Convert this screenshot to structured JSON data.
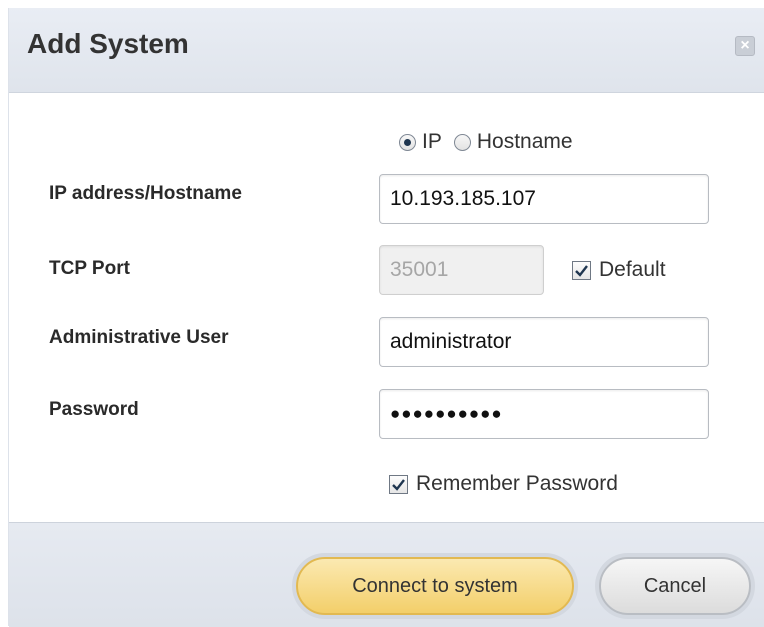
{
  "dialog": {
    "title": "Add System",
    "close_symbol": "×"
  },
  "address_type": {
    "options": [
      {
        "label": "IP",
        "selected": true
      },
      {
        "label": "Hostname",
        "selected": false
      }
    ]
  },
  "fields": {
    "ip_label": "IP address/Hostname",
    "ip_value": "10.193.185.107",
    "port_label": "TCP Port",
    "port_value": "35001",
    "port_default_label": "Default",
    "port_default_checked": true,
    "user_label": "Administrative User",
    "user_value": "administrator",
    "password_label": "Password",
    "password_value": "●●●●●●●●●●",
    "remember_label": "Remember Password",
    "remember_checked": true
  },
  "actions": {
    "connect_label": "Connect to system",
    "cancel_label": "Cancel"
  },
  "colors": {
    "primary_button": "#f3cf6a",
    "header_bg": "#e9edf4"
  }
}
